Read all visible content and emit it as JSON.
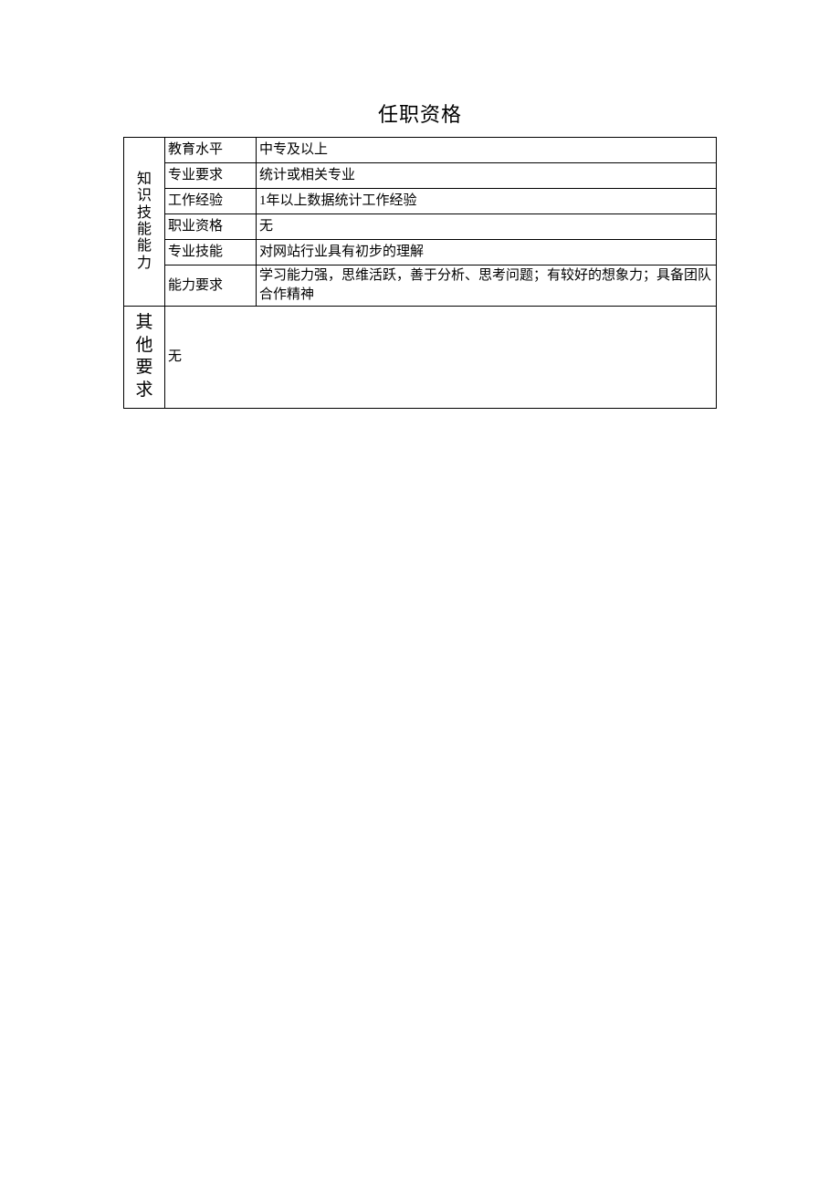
{
  "title": "任职资格",
  "section1": {
    "header": "知识技能能力",
    "rows": [
      {
        "label": "教育水平",
        "value": "中专及以上"
      },
      {
        "label": "专业要求",
        "value": "统计或相关专业"
      },
      {
        "label": "工作经验",
        "value": "1年以上数据统计工作经验"
      },
      {
        "label": "职业资格",
        "value": "无"
      },
      {
        "label": "专业技能",
        "value": "对网站行业具有初步的理解"
      },
      {
        "label": "能力要求",
        "value": "学习能力强，思维活跃，善于分析、思考问题；有较好的想象力；具备团队合作精神"
      }
    ]
  },
  "section2": {
    "header": "其他要求",
    "value": "无"
  }
}
